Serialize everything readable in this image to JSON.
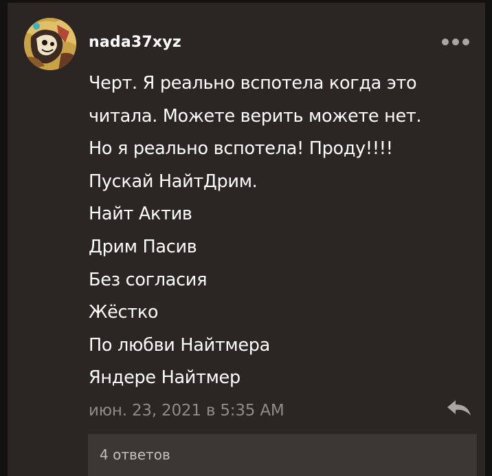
{
  "comment": {
    "username": "nada37xyz",
    "avatar_icon": "user-avatar-icon",
    "more_icon": "more-options-icon",
    "text_lines": [
      "Черт. Я реально вспотела когда это",
      "читала. Можете верить можете нет.",
      "Но я реально вспотела! Проду!!!!",
      "Пускай НайтДрим.",
      "Найт Актив",
      "Дрим Пасив",
      "Без согласия",
      "Жёстко",
      "По любви Найтмера",
      "Яндере Найтмер"
    ],
    "timestamp": "июн. 23, 2021 в 5:35 AM",
    "reply_icon": "reply-arrow-icon",
    "replies_label": "4 ответов"
  },
  "colors": {
    "background": "#141210",
    "card": "#2b2624",
    "replies_bar": "#3c3735",
    "text": "#ffffff",
    "muted": "#8f8b88"
  }
}
